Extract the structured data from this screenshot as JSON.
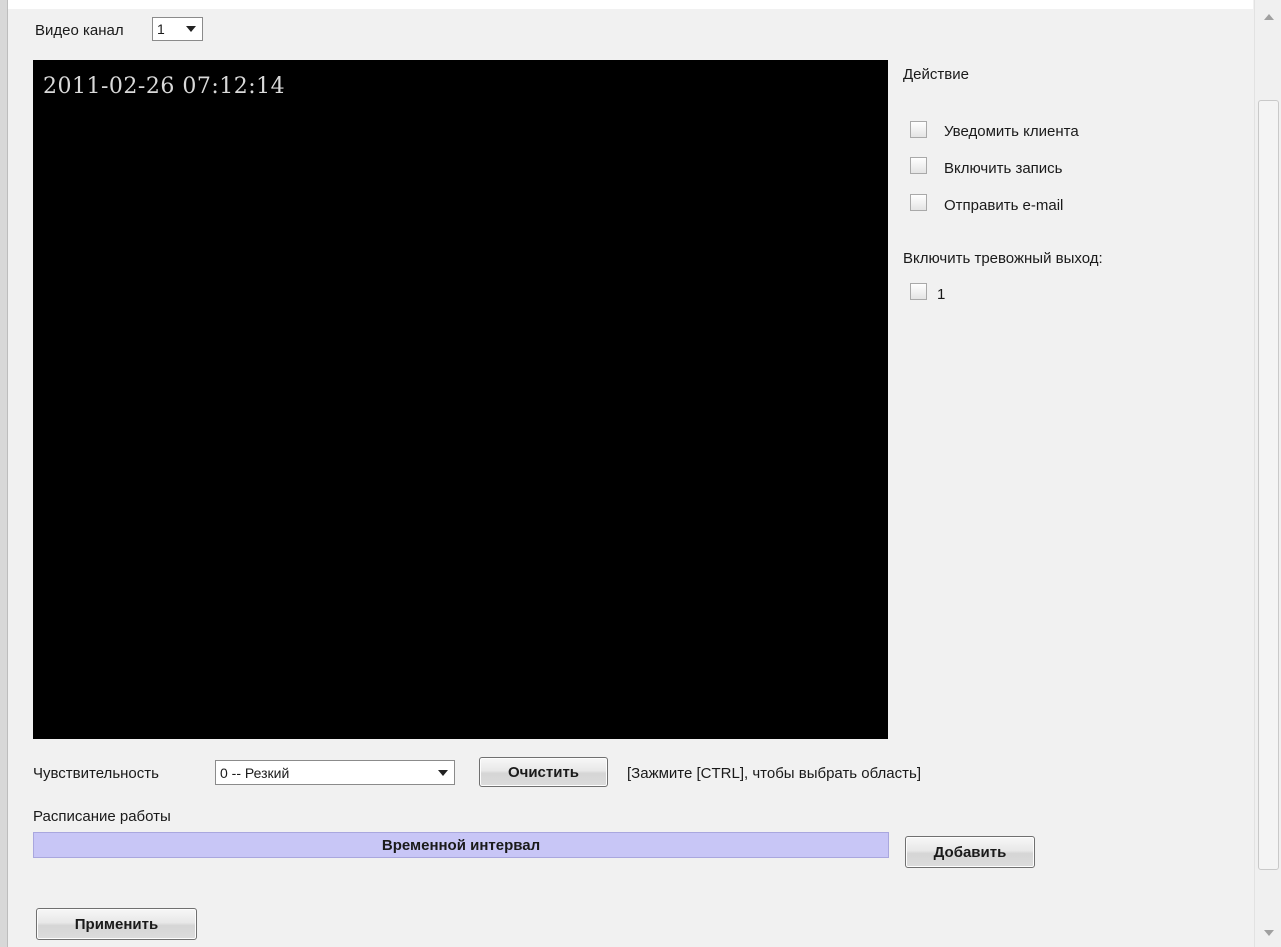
{
  "video_channel": {
    "label": "Видео канал",
    "value": "1"
  },
  "video": {
    "timestamp": "2011-02-26 07:12:14"
  },
  "action": {
    "title": "Действие",
    "options": [
      {
        "label": "Уведомить клиента",
        "checked": false
      },
      {
        "label": "Включить запись",
        "checked": false
      },
      {
        "label": "Отправить e-mail",
        "checked": false
      }
    ],
    "alarm_output": {
      "label": "Включить тревожный выход:",
      "items": [
        {
          "label": "1",
          "checked": false
        }
      ]
    }
  },
  "sensitivity": {
    "label": "Чувствительность",
    "value": "0 -- Резкий",
    "clear_button": "Очистить",
    "hint": "[Зажмите [CTRL], чтобы выбрать область]"
  },
  "schedule": {
    "label": "Расписание работы",
    "header": "Временной интервал",
    "add_button": "Добавить"
  },
  "apply_button": "Применить"
}
